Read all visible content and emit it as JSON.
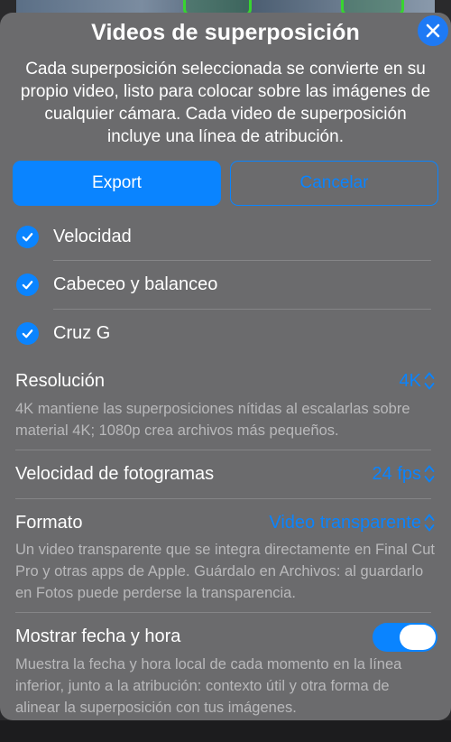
{
  "sheet": {
    "title": "Videos de superposición",
    "subtitle": "Cada superposición seleccionada se convierte en su propio video, listo para colocar sobre las imágenes de cualquier cámara. Cada video de superposición incluye una línea de atribución.",
    "close_icon": "close-x-icon"
  },
  "actions": {
    "export_label": "Export",
    "cancel_label": "Cancelar"
  },
  "overlays": [
    {
      "label": "Velocidad",
      "checked": true
    },
    {
      "label": "Cabeceo y balanceo",
      "checked": true
    },
    {
      "label": "Cruz G",
      "checked": true
    }
  ],
  "settings": {
    "resolution": {
      "label": "Resolución",
      "value": "4K",
      "description": "4K mantiene las superposiciones nítidas al escalarlas sobre material 4K; 1080p crea archivos más pequeños."
    },
    "framerate": {
      "label": "Velocidad de fotogramas",
      "value": "24 fps"
    },
    "format": {
      "label": "Formato",
      "value": "Video transparente",
      "description": "Un video transparente que se integra directamente en Final Cut Pro y otras apps de Apple. Guárdalo en Archivos: al guardarlo en Fotos puede perderse la transparencia."
    },
    "timestamp": {
      "label": "Mostrar fecha y hora",
      "enabled": true,
      "description": "Muestra la fecha y hora local de cada momento en la línea inferior, junto a la atribución: contexto útil y otra forma de alinear la superposición con tus imágenes."
    }
  },
  "colors": {
    "accent": "#0a84ff",
    "sheet_background": "#6b6b6d",
    "secondary_text": "#b9b9bb"
  }
}
